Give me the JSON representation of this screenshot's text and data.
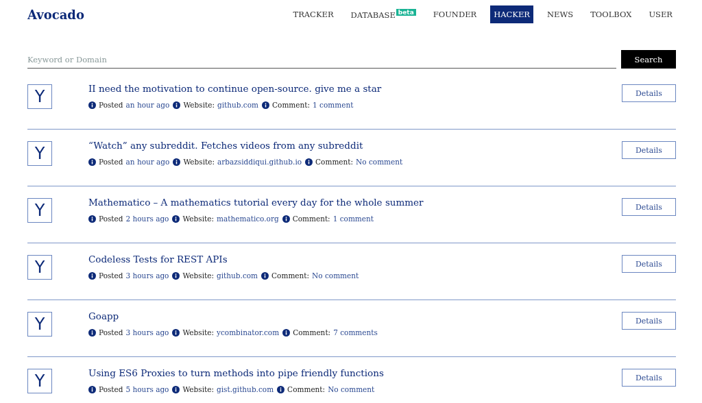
{
  "brand": "Avocado",
  "nav": [
    {
      "label": "TRACKER",
      "selected": false
    },
    {
      "label": "DATABASE",
      "badge": "beta",
      "selected": false
    },
    {
      "label": "FOUNDER",
      "selected": false
    },
    {
      "label": "HACKER",
      "selected": true
    },
    {
      "label": "NEWS",
      "selected": false
    },
    {
      "label": "TOOLBOX",
      "selected": false
    },
    {
      "label": "USER",
      "selected": false
    }
  ],
  "search": {
    "placeholder": "Keyword or Domain",
    "button": "Search"
  },
  "posts": [
    {
      "logo": "Y",
      "title": "II need the motivation to continue open-source. give me a star",
      "posted_label": "Posted",
      "posted": "an hour ago",
      "website_label": "Website:",
      "website": "github.com",
      "comment_label": "Comment:",
      "comment": "1 comment",
      "button": "Details"
    },
    {
      "logo": "Y",
      "title": "“Watch” any subreddit. Fetches videos from any subreddit",
      "posted_label": "Posted",
      "posted": "an hour ago",
      "website_label": "Website:",
      "website": "arbazsiddiqui.github.io",
      "comment_label": "Comment:",
      "comment": "No comment",
      "button": "Details"
    },
    {
      "logo": "Y",
      "title": "Mathematico – A mathematics tutorial every day for the whole summer",
      "posted_label": "Posted",
      "posted": "2 hours ago",
      "website_label": "Website:",
      "website": "mathematico.org",
      "comment_label": "Comment:",
      "comment": "1 comment",
      "button": "Details"
    },
    {
      "logo": "Y",
      "title": "Codeless Tests for REST APIs",
      "posted_label": "Posted",
      "posted": "3 hours ago",
      "website_label": "Website:",
      "website": "github.com",
      "comment_label": "Comment:",
      "comment": "No comment",
      "button": "Details"
    },
    {
      "logo": "Y",
      "title": "Goapp",
      "posted_label": "Posted",
      "posted": "3 hours ago",
      "website_label": "Website:",
      "website": "ycombinator.com",
      "comment_label": "Comment:",
      "comment": "7 comments",
      "button": "Details"
    },
    {
      "logo": "Y",
      "title": "Using ES6 Proxies to turn methods into pipe friendly functions",
      "posted_label": "Posted",
      "posted": "5 hours ago",
      "website_label": "Website:",
      "website": "gist.github.com",
      "comment_label": "Comment:",
      "comment": "No comment",
      "button": "Details"
    }
  ]
}
